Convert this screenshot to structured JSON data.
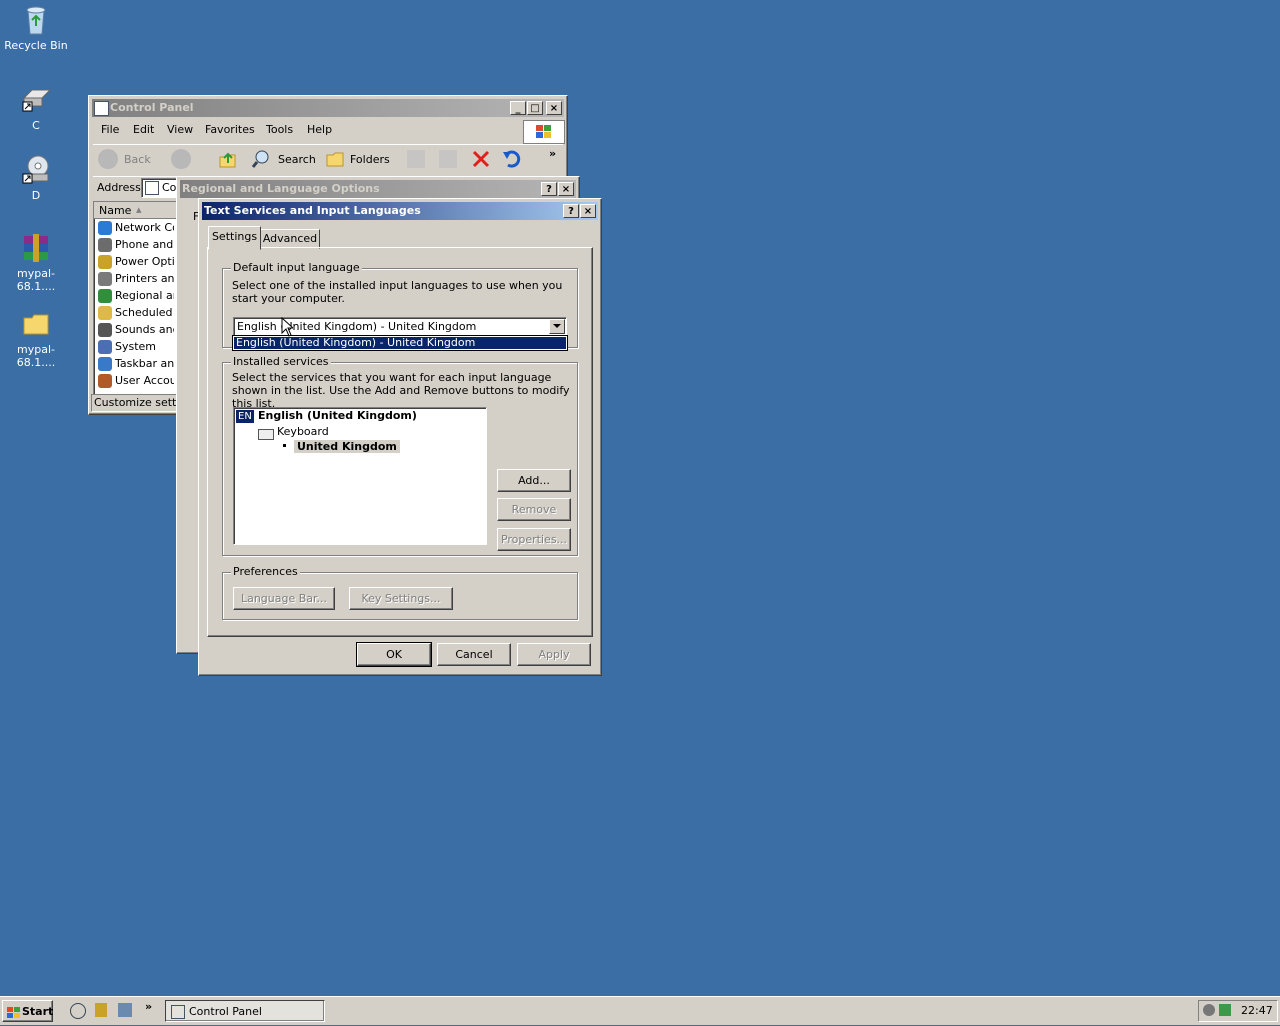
{
  "desktop": {
    "icons": [
      {
        "label": "Recycle Bin",
        "icon": "recycle-bin-icon"
      },
      {
        "label": "C",
        "icon": "drive-c-icon"
      },
      {
        "label": "D",
        "icon": "cd-drive-icon"
      },
      {
        "label": "mypal-68.1....",
        "icon": "winrar-archive-icon"
      },
      {
        "label": "mypal-68.1....",
        "icon": "folder-icon"
      }
    ]
  },
  "control_panel": {
    "title": "Control Panel",
    "menu": [
      "File",
      "Edit",
      "View",
      "Favorites",
      "Tools",
      "Help"
    ],
    "toolbar": {
      "back": "Back",
      "search": "Search",
      "folders": "Folders"
    },
    "address_label": "Address",
    "address_value": "Co",
    "list_header": "Name",
    "items": [
      {
        "label": "Network Cor",
        "color": "#2a7ad6"
      },
      {
        "label": "Phone and M",
        "color": "#6c6c6c"
      },
      {
        "label": "Power Optio",
        "color": "#c9a227"
      },
      {
        "label": "Printers and",
        "color": "#7a7a7a"
      },
      {
        "label": "Regional and",
        "color": "#2f8f3a"
      },
      {
        "label": "Scheduled Ta",
        "color": "#e0b84a"
      },
      {
        "label": "Sounds and A",
        "color": "#555555"
      },
      {
        "label": "System",
        "color": "#4a6fb3"
      },
      {
        "label": "Taskbar and",
        "color": "#3a78c8"
      },
      {
        "label": "User Accoun",
        "color": "#b05a2a"
      }
    ],
    "status": "Customize setting"
  },
  "regional_dialog": {
    "title": "Regional and Language Options",
    "tab_fragment": "F"
  },
  "text_services_dialog": {
    "title": "Text Services and Input Languages",
    "tabs": [
      "Settings",
      "Advanced"
    ],
    "default_group_label": "Default input language",
    "default_desc": "Select one of the installed input languages to use when you start your computer.",
    "combo_value": "English (United Kingdom) - United Kingdom",
    "dropdown_option": "English (United Kingdom) - United Kingdom",
    "installed_group_label": "Installed services",
    "installed_desc": "Select the services that you want for each input language shown in the list. Use the Add and Remove buttons to modify this list.",
    "tree": {
      "lang_badge": "EN",
      "language": "English (United Kingdom)",
      "category": "Keyboard",
      "layout": "United Kingdom"
    },
    "buttons": {
      "add": "Add...",
      "remove": "Remove",
      "properties": "Properties..."
    },
    "preferences_label": "Preferences",
    "pref_buttons": {
      "language_bar": "Language Bar...",
      "key_settings": "Key Settings..."
    },
    "footer": {
      "ok": "OK",
      "cancel": "Cancel",
      "apply": "Apply"
    }
  },
  "taskbar": {
    "start": "Start",
    "task_button": "Control Panel",
    "clock": "22:47"
  }
}
